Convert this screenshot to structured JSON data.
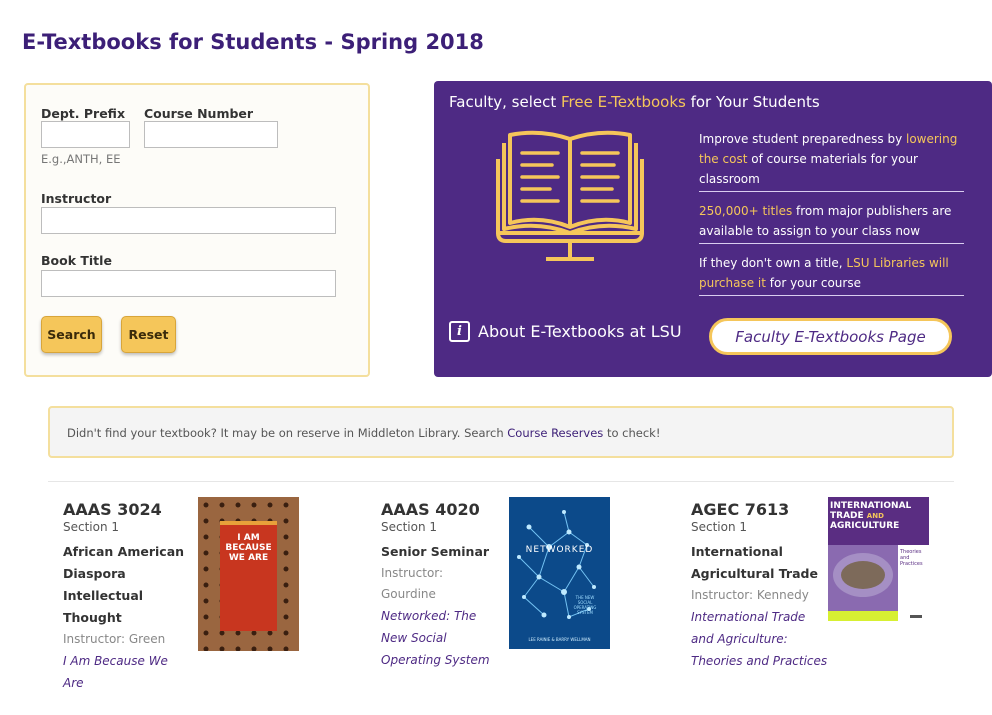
{
  "page": {
    "title": "E-Textbooks for Students - Spring 2018"
  },
  "search": {
    "dept_label": "Dept. Prefix",
    "dept_value": "",
    "course_label": "Course Number",
    "course_value": "",
    "dept_hint": "E.g.,ANTH, EE",
    "instructor_label": "Instructor",
    "instructor_value": "",
    "title_label": "Book Title",
    "title_value": "",
    "search_button": "Search",
    "reset_button": "Reset"
  },
  "promo": {
    "heading_pre": "Faculty, select ",
    "heading_highlight": "Free E-Textbooks",
    "heading_post": " for Your Students",
    "bullets": [
      {
        "pre": "Improve student preparedness by ",
        "highlight": "lowering the cost",
        "post": " of course materials for your classroom"
      },
      {
        "pre": "",
        "highlight": "250,000+ titles",
        "post": " from major publishers are available to assign to your class now"
      },
      {
        "pre": "If they don't own a title, ",
        "highlight": "LSU Libraries will purchase it",
        "post": " for your course"
      }
    ],
    "about_icon": "i",
    "about_label": "About E-Textbooks at LSU",
    "faculty_button": "Faculty E-Textbooks Page"
  },
  "notice": {
    "pre": "Didn't find your textbook? It may be on reserve in Middleton Library. Search ",
    "link": "Course Reserves",
    "post": " to check!"
  },
  "courses": [
    {
      "code": "AAAS 3024",
      "section": "Section 1",
      "name_lines": [
        "African American",
        "Diaspora",
        "Intellectual",
        "Thought"
      ],
      "instructor_lines": [
        "Instructor: Green"
      ],
      "book_lines": [
        "I Am Because We",
        "Are"
      ],
      "cover": {
        "title_lines": [
          "I AM",
          "BECAUSE",
          "WE ARE"
        ]
      }
    },
    {
      "code": "AAAS 4020",
      "section": "Section 1",
      "name_lines": [
        "Senior Seminar"
      ],
      "instructor_lines": [
        "Instructor:",
        "Gourdine"
      ],
      "book_lines": [
        "Networked: The",
        "New Social",
        "Operating System"
      ],
      "cover": {
        "title": "NETWORKED",
        "subtitle_lines": [
          "THE NEW",
          "SOCIAL",
          "OPERATING",
          "SYSTEM"
        ],
        "authors": "LEE RAINIE & BARRY WELLMAN"
      }
    },
    {
      "code": "AGEC 7613",
      "section": "Section 1",
      "name_lines": [
        "International",
        "Agricultural Trade"
      ],
      "instructor_lines": [
        "Instructor: Kennedy"
      ],
      "book_lines": [
        "International Trade",
        "and Agriculture:",
        "Theories and Practices"
      ],
      "cover": {
        "title_lines": [
          "INTERNATIONAL",
          "TRADE",
          "AGRICULTURE"
        ],
        "and_word": "AND",
        "subtitle_lines": [
          "Theories",
          "and",
          "Practices"
        ]
      }
    }
  ],
  "colors": {
    "purple": "#4e2a84",
    "gold": "#f5c65a",
    "title": "#3c1f77"
  }
}
